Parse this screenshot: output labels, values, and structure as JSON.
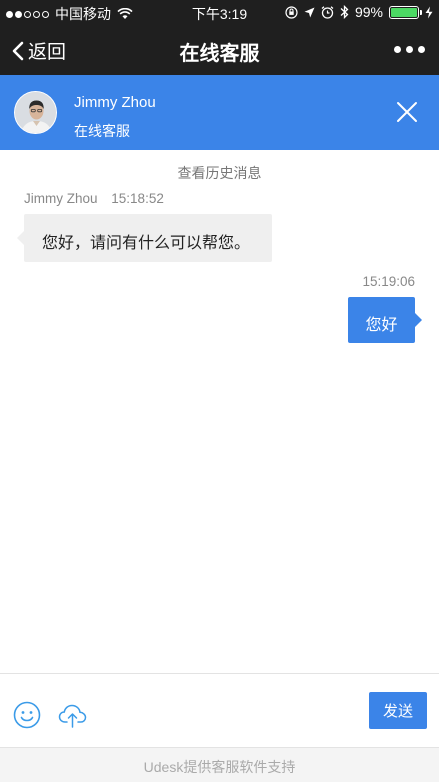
{
  "status_bar": {
    "carrier": "中国移动",
    "time": "下午3:19",
    "battery_percent": "99%",
    "battery_level": 0.99,
    "signal_dots_on": 2,
    "signal_dots_total": 5
  },
  "nav": {
    "back_label": "返回",
    "title": "在线客服"
  },
  "agent": {
    "name": "Jimmy Zhou",
    "role": "在线客服"
  },
  "chat": {
    "history_link": "查看历史消息",
    "messages": [
      {
        "sender": "Jimmy Zhou",
        "time": "15:18:52",
        "text": "您好，请问有什么可以帮您。",
        "direction": "incoming"
      },
      {
        "time": "15:19:06",
        "text": "您好",
        "direction": "outgoing"
      }
    ]
  },
  "input": {
    "send_label": "发送"
  },
  "footer": {
    "text": "Udesk提供客服软件支持"
  },
  "colors": {
    "accent": "#3b84e8",
    "bar_dark": "#1f1f1f",
    "incoming_bubble": "#efefef"
  }
}
